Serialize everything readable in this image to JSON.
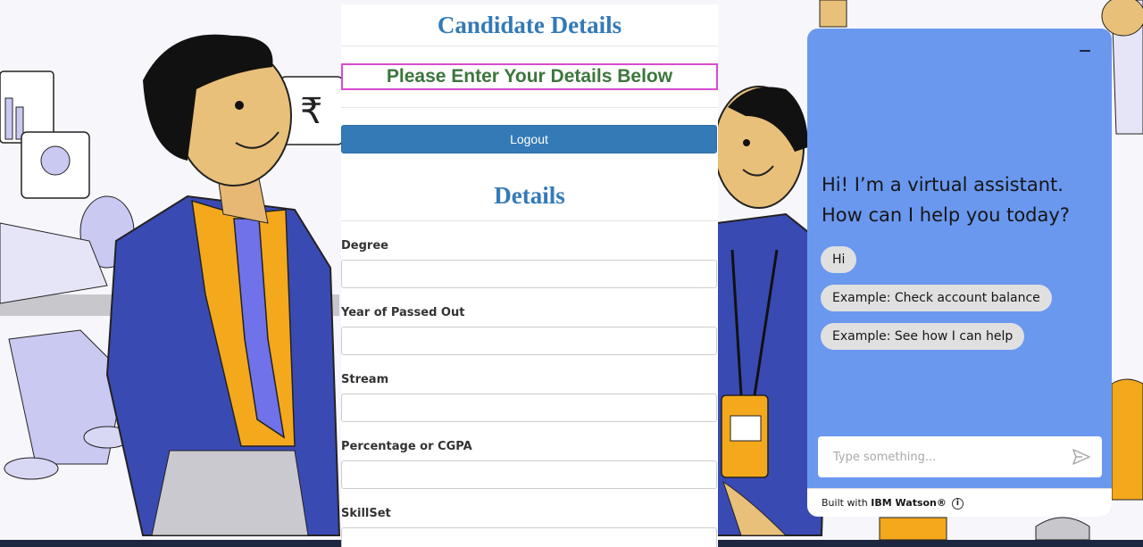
{
  "page": {
    "title": "Candidate Details",
    "subtitle": "Please Enter Your Details Below",
    "logout_label": "Logout",
    "section_title": "Details"
  },
  "form": {
    "fields": [
      {
        "label": "Degree",
        "value": ""
      },
      {
        "label": "Year of Passed Out",
        "value": ""
      },
      {
        "label": "Stream",
        "value": ""
      },
      {
        "label": "Percentage or CGPA",
        "value": ""
      },
      {
        "label": "SkillSet",
        "value": ""
      }
    ]
  },
  "chat": {
    "greeting": "Hi! I’m a virtual assistant. How can I help you today?",
    "suggestions": [
      "Hi",
      "Example: Check account balance",
      "Example: See how I can help"
    ],
    "input_placeholder": "Type something...",
    "footer_prefix": "Built with ",
    "footer_brand": "IBM Watson®",
    "minimize_icon": "minimize-icon",
    "send_icon": "send-icon",
    "info_icon": "info-icon"
  },
  "colors": {
    "primary_blue": "#337ab7",
    "subtitle_green": "#3c763d",
    "subtitle_border": "#d84bd0",
    "chat_background": "#6a98ef"
  }
}
